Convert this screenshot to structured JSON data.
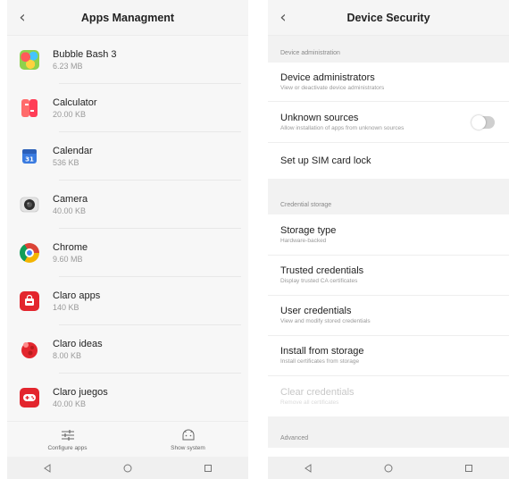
{
  "apps_screen": {
    "title": "Apps Managment",
    "apps": [
      {
        "name": "Bubble Bash 3",
        "size": "6.23 MB",
        "icon": "bubble-bash-icon"
      },
      {
        "name": "Calculator",
        "size": "20.00 KB",
        "icon": "calculator-icon"
      },
      {
        "name": "Calendar",
        "size": "536 KB",
        "icon": "calendar-icon"
      },
      {
        "name": "Camera",
        "size": "40.00 KB",
        "icon": "camera-icon"
      },
      {
        "name": "Chrome",
        "size": "9.60 MB",
        "icon": "chrome-icon"
      },
      {
        "name": "Claro apps",
        "size": "140 KB",
        "icon": "claro-apps-icon"
      },
      {
        "name": "Claro ideas",
        "size": "8.00 KB",
        "icon": "claro-ideas-icon"
      },
      {
        "name": "Claro juegos",
        "size": "40.00 KB",
        "icon": "claro-juegos-icon"
      }
    ],
    "actions": {
      "configure": "Configure apps",
      "show_system": "Show system"
    }
  },
  "security_screen": {
    "title": "Device Security",
    "sections": {
      "device_admin": "Device administration",
      "credential_storage": "Credential storage",
      "advanced": "Advanced"
    },
    "items": {
      "device_admins": {
        "title": "Device administrators",
        "subtitle": "View or deactivate device administrators"
      },
      "unknown_sources": {
        "title": "Unknown sources",
        "subtitle": "Allow installation of apps from unknown sources",
        "enabled": false
      },
      "sim_lock": {
        "title": "Set up SIM card lock"
      },
      "storage_type": {
        "title": "Storage type",
        "subtitle": "Hardware-backed"
      },
      "trusted_credentials": {
        "title": "Trusted credentials",
        "subtitle": "Display trusted CA certificates"
      },
      "user_credentials": {
        "title": "User credentials",
        "subtitle": "View and modify stored credentials"
      },
      "install_from_storage": {
        "title": "Install from storage",
        "subtitle": "Install certificates from storage"
      },
      "clear_credentials": {
        "title": "Clear credentials",
        "subtitle": "Remove all certificates"
      }
    }
  },
  "colors": {
    "chrome_red": "#db4437",
    "chrome_yellow": "#f4b400",
    "chrome_green": "#0f9d58",
    "chrome_blue": "#4285f4",
    "claro_red": "#e3262e",
    "toggle_off": "#cfcfcf"
  }
}
